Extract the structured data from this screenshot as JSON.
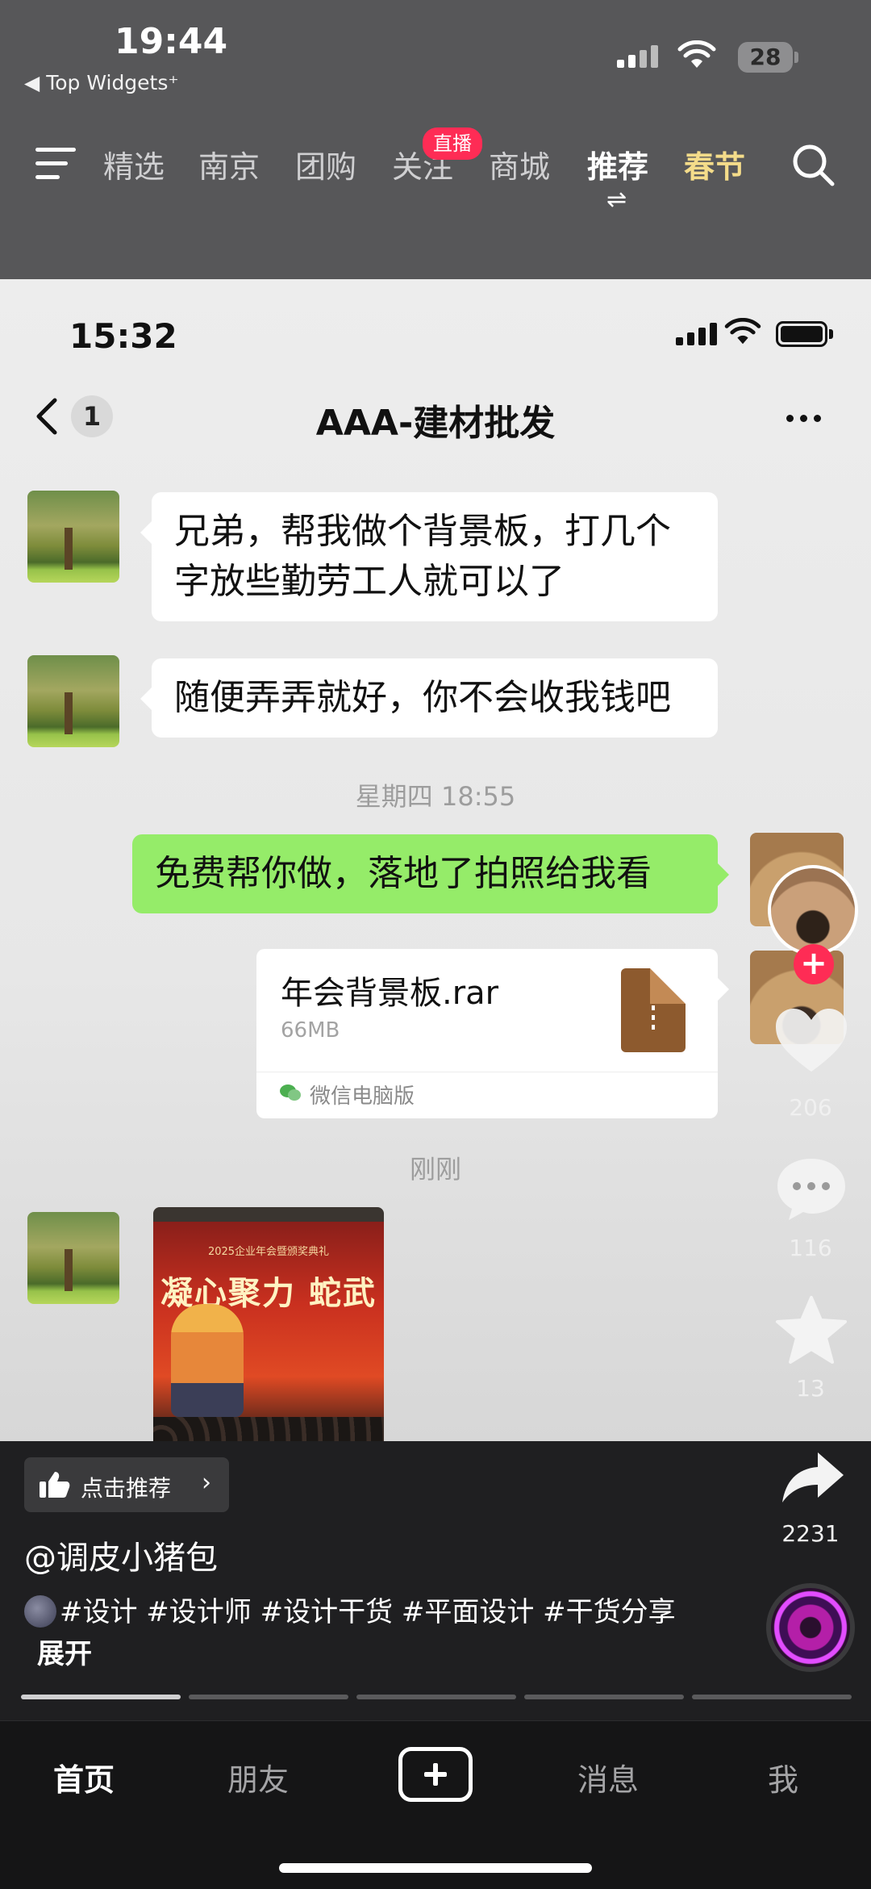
{
  "outer_status": {
    "time": "19:44",
    "back_label": "Top Widgets⁺",
    "battery": "28"
  },
  "top_nav": {
    "tabs": [
      "精选",
      "南京",
      "团购",
      "关注",
      "商城",
      "推荐",
      "春节"
    ],
    "live_badge": "直播",
    "active_tab": "推荐",
    "festival_color": "#f4dc8a",
    "live_badge_color": "#fe2c55"
  },
  "chat": {
    "status_time": "15:32",
    "unread_count": "1",
    "title": "AAA-建材批发",
    "messages": [
      {
        "from": "other",
        "lines": [
          "兄弟，帮我做个背景板，打几个",
          "字放些勤劳工人就可以了"
        ]
      },
      {
        "from": "other",
        "lines": [
          "随便弄弄就好，你不会收我钱吧"
        ]
      },
      {
        "from": "me",
        "lines": [
          "免费帮你做，落地了拍照给我看"
        ]
      }
    ],
    "timestamps": [
      "星期四 18:55",
      "刚刚"
    ],
    "file": {
      "name": "年会背景板.rar",
      "size": "66MB",
      "source": "微信电脑版"
    },
    "photo": {
      "header": "2025企业年会暨颁奖典礼",
      "slogan": "凝心聚力 蛇武"
    },
    "my_bubble_color": "#95ec69"
  },
  "actions": {
    "likes": "206",
    "comments": "116",
    "favorites": "13",
    "shares": "2231"
  },
  "video_info": {
    "recommend_label": "点击推荐",
    "author": "@调皮小猪包",
    "description": "#设计 #设计师 #设计干货 #平面设计 #干货分享",
    "expand_label": "展开",
    "progress_segments": 5,
    "progress_current": 1
  },
  "tabbar": {
    "tabs": [
      "首页",
      "朋友",
      "消息",
      "我"
    ],
    "active": "首页"
  }
}
